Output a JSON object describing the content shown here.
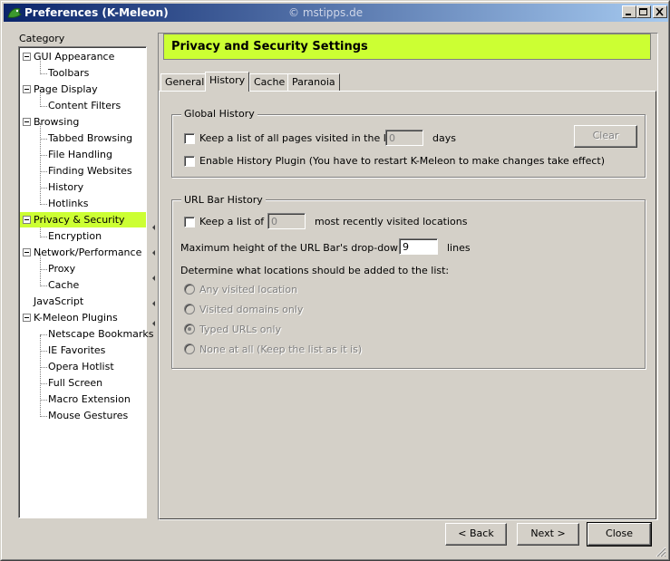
{
  "window": {
    "title": "Preferences (K-Meleon)",
    "watermark": "© mstipps.de"
  },
  "category": {
    "label": "Category",
    "items": [
      {
        "label": "GUI Appearance"
      },
      {
        "label": "Toolbars"
      },
      {
        "label": "Page Display"
      },
      {
        "label": "Content Filters"
      },
      {
        "label": "Browsing"
      },
      {
        "label": "Tabbed Browsing"
      },
      {
        "label": "File Handling"
      },
      {
        "label": "Finding Websites"
      },
      {
        "label": "History"
      },
      {
        "label": "Hotlinks"
      },
      {
        "label": "Privacy & Security"
      },
      {
        "label": "Encryption"
      },
      {
        "label": "Network/Performance"
      },
      {
        "label": "Proxy"
      },
      {
        "label": "Cache"
      },
      {
        "label": "JavaScript"
      },
      {
        "label": "K-Meleon Plugins"
      },
      {
        "label": "Netscape Bookmarks"
      },
      {
        "label": "IE Favorites"
      },
      {
        "label": "Opera Hotlist"
      },
      {
        "label": "Full Screen"
      },
      {
        "label": "Macro Extension"
      },
      {
        "label": "Mouse Gestures"
      }
    ],
    "selected": "Privacy & Security"
  },
  "header": {
    "title": "Privacy and Security Settings",
    "color": "#ccff33"
  },
  "tabs": [
    {
      "label": "General"
    },
    {
      "label": "History"
    },
    {
      "label": "Cache"
    },
    {
      "label": "Paranoia"
    }
  ],
  "active_tab": "History",
  "global_history": {
    "legend": "Global History",
    "keep_list_label": "Keep a list of all pages visited in the last",
    "days_value": "0",
    "days_label": "days",
    "clear_label": "Clear",
    "plugin_label": "Enable History Plugin (You have to restart K-Meleon to make changes take effect)"
  },
  "url_bar_history": {
    "legend": "URL Bar History",
    "keep_list_label": "Keep a list of",
    "count_value": "0",
    "count_suffix": "most recently visited locations",
    "max_height_label": "Maximum height of the URL Bar's drop-down list:",
    "max_height_value": "9",
    "lines_label": "lines",
    "determine_label": "Determine what locations should be added to the list:",
    "options": [
      {
        "label": "Any visited location"
      },
      {
        "label": "Visited domains only"
      },
      {
        "label": "Typed URLs only"
      },
      {
        "label": "None at all (Keep the list as it is)"
      }
    ],
    "selected_option": "Typed URLs only"
  },
  "footer": {
    "back_label": "< Back",
    "next_label": "Next >",
    "close_label": "Close"
  }
}
